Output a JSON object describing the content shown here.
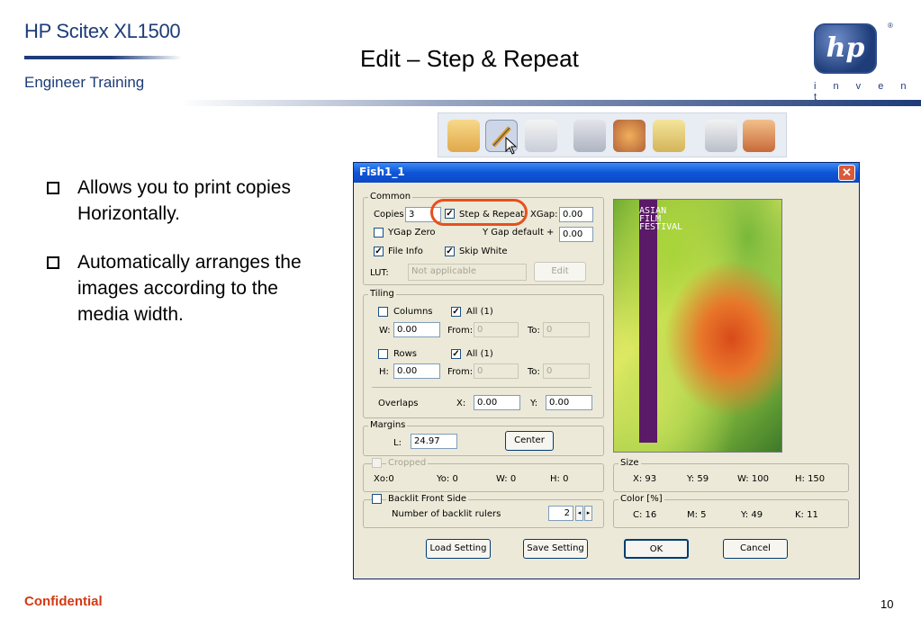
{
  "slide": {
    "brand": "HP Scitex XL1500",
    "subtitle": "Engineer  Training",
    "title": "Edit – Step & Repeat",
    "logo_text": "hp",
    "logo_tagline": "i n v e n t",
    "confidential": "Confidential",
    "page_number": "10",
    "colors": {
      "brand_blue": "#1d3c78",
      "confidential_red": "#d23a12",
      "highlight": "#e6501e"
    }
  },
  "toolbar": {
    "icons": [
      "folder-icon",
      "edit-pencil-icon",
      "print-queue-icon",
      "tools-icon",
      "gears-icon",
      "scroll-icon",
      "trash-icon",
      "exit-icon"
    ]
  },
  "bullets": [
    "Allows you to print copies Horizontally.",
    "Automatically arranges the images according to the media width."
  ],
  "dialog": {
    "title": "Fish1_1",
    "close_glyph": "✕",
    "common": {
      "label": "Common",
      "copies_label": "Copies",
      "copies_value": "3",
      "step_repeat_label": "Step & Repeat",
      "step_repeat_checked": true,
      "xgap_label": "XGap:",
      "xgap_value": "0.00",
      "ygap_zero_label": "YGap Zero",
      "ygap_zero_checked": false,
      "ygap_default_label": "Y Gap default +",
      "ygap_value": "0.00",
      "file_info_label": "File Info",
      "file_info_checked": true,
      "skip_white_label": "Skip White",
      "skip_white_checked": true,
      "lut_label": "LUT:",
      "lut_value": "Not applicable",
      "edit_button": "Edit"
    },
    "tiling": {
      "label": "Tiling",
      "columns_label": "Columns",
      "columns_checked": false,
      "all_cols_label": "All (1)",
      "all_cols_checked": true,
      "w_label": "W:",
      "w_value": "0.00",
      "from_label": "From:",
      "from_cols_value": "0",
      "to_label": "To:",
      "to_cols_value": "0",
      "rows_label": "Rows",
      "rows_checked": false,
      "all_rows_label": "All (1)",
      "all_rows_checked": true,
      "h_label": "H:",
      "h_value": "0.00",
      "from_rows_value": "0",
      "to_rows_value": "0",
      "overlaps_label": "Overlaps",
      "x_label": "X:",
      "x_value": "0.00",
      "y_label": "Y:",
      "y_value": "0.00"
    },
    "margins": {
      "label": "Margins",
      "l_label": "L:",
      "l_value": "24.97",
      "center_button": "Center"
    },
    "cropped": {
      "label": "Cropped",
      "checked": false,
      "xo": "Xo:0",
      "yo": "Yo: 0",
      "w": "W: 0",
      "h": "H:  0"
    },
    "backlit": {
      "label": "Backlit Front Side",
      "checked": false,
      "rulers_label": "Number of backlit rulers",
      "rulers_value": "2"
    },
    "size": {
      "label": "Size",
      "x": "X:   93",
      "y": "Y:   59",
      "w": "W:   100",
      "h": "H:   150"
    },
    "color": {
      "label": "Color [%]",
      "c": "C:  16",
      "m": "M:  5",
      "y": "Y:  49",
      "k": "K:  11"
    },
    "preview_band_text": "ASIAN FILM FESTIVAL",
    "buttons": {
      "load": "Load Setting",
      "save": "Save Setting",
      "ok": "OK",
      "cancel": "Cancel"
    }
  }
}
